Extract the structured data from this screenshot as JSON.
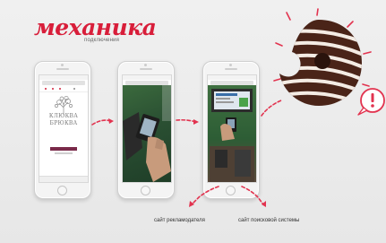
{
  "brand": {
    "logo_text": "механика",
    "tagline": "подключения",
    "accent_color": "#d81e3a"
  },
  "phones": [
    {
      "label": "phone-advertiser-site",
      "site_logo": "КЛЮКВА\nБРЮКВА"
    },
    {
      "label": "phone-payment-terminal"
    },
    {
      "label": "phone-kiosk-screen"
    }
  ],
  "captions": {
    "advertiser": "сайт рекламодателя",
    "search": "сайт поисковой системы"
  },
  "decorations": {
    "donut": "chocolate-striped-donut",
    "alert_icon": "exclamation-mark-icon"
  }
}
